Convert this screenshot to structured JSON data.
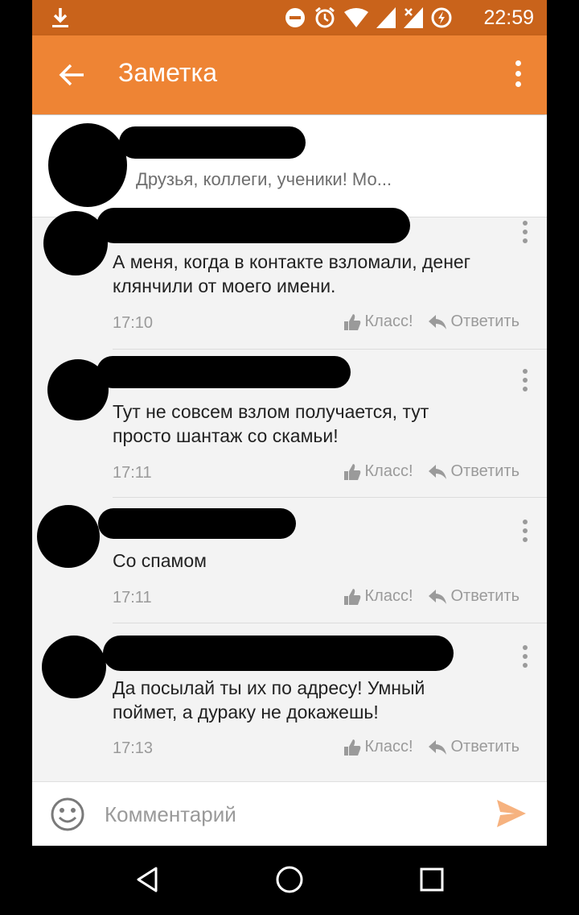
{
  "status_bar": {
    "time": "22:59"
  },
  "app_bar": {
    "title": "Заметка"
  },
  "note": {
    "preview": "Друзья, коллеги, ученики! Мо..."
  },
  "comments": [
    {
      "text": "А меня, когда в контакте взломали, денег клянчили от моего имени.",
      "time": "17:10",
      "like_label": "Класс!",
      "reply_label": "Ответить"
    },
    {
      "text": "Тут не совсем взлом получается, тут просто шантаж со скамьи!",
      "time": "17:11",
      "like_label": "Класс!",
      "reply_label": "Ответить"
    },
    {
      "text": "Со спамом",
      "time": "17:11",
      "like_label": "Класс!",
      "reply_label": "Ответить"
    },
    {
      "text": "Да посылай ты их по адресу! Умный поймет, а дураку не докажешь!",
      "time": "17:13",
      "like_label": "Класс!",
      "reply_label": "Ответить"
    }
  ],
  "composer": {
    "placeholder": "Комментарий"
  },
  "colors": {
    "accent": "#ee8434",
    "status_bar": "#c9631b",
    "send": "#f6b27f"
  }
}
